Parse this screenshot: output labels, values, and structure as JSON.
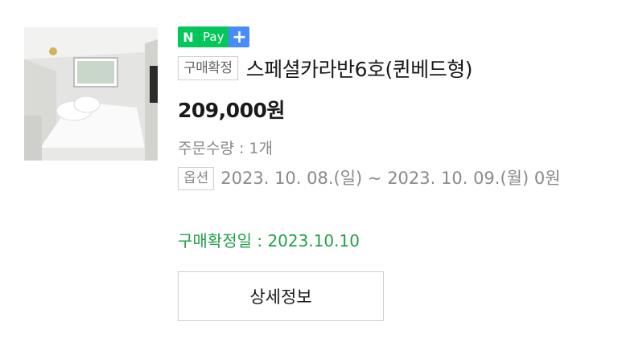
{
  "order": {
    "npay_badge": {
      "n": "N",
      "pay": "Pay",
      "plus": "+",
      "colors": {
        "n_bg": "#03c75a",
        "plus_bg": "#4a8cf7"
      }
    },
    "status_tag": "구매확정",
    "product_name": "스페셜카라반6호(퀸베드형)",
    "price": "209,000원",
    "quantity": "주문수량 : 1개",
    "option_tag": "옵션",
    "option_text": "2023. 10. 08.(일) ~ 2023. 10. 09.(월) 0원",
    "confirm_date": "구매확정일 : 2023.10.10",
    "detail_button": "상세정보",
    "accent_color": "#21a04a"
  }
}
